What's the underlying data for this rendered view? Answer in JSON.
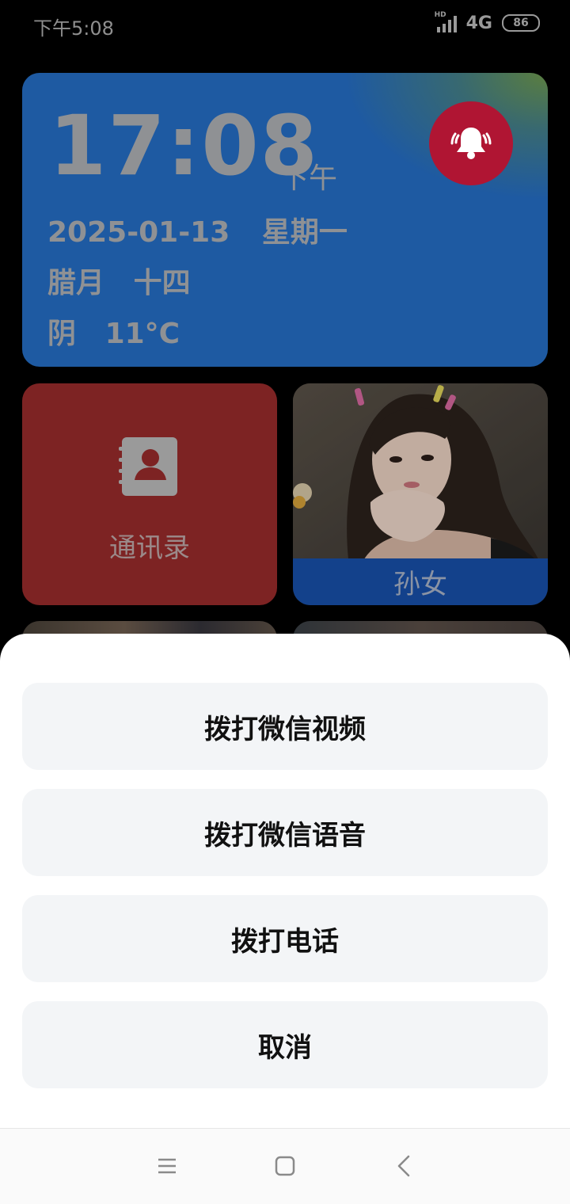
{
  "status_bar": {
    "time": "下午5:08",
    "signal_badge": "HD",
    "network": "4G",
    "battery": "86"
  },
  "clock_card": {
    "time": "17:08",
    "ampm": "下午",
    "date": "2025-01-13",
    "weekday": "星期一",
    "lunar_month": "腊月",
    "lunar_day": "十四",
    "weather": "阴",
    "temperature": "11°C",
    "alarm_icon": "alarm-bell-icon",
    "alarm_color": "#b01533"
  },
  "tiles": {
    "contacts": {
      "label": "通讯录",
      "icon": "contacts-book-icon",
      "color": "#7d2323"
    },
    "granddaughter": {
      "label": "孙女",
      "bar_color": "#13418b"
    }
  },
  "action_sheet": {
    "buttons": [
      {
        "label": "拨打微信视频"
      },
      {
        "label": "拨打微信语音"
      },
      {
        "label": "拨打电话"
      },
      {
        "label": "取消"
      }
    ]
  },
  "nav_bar": {
    "icons": [
      "menu-icon",
      "home-icon",
      "back-icon"
    ]
  }
}
